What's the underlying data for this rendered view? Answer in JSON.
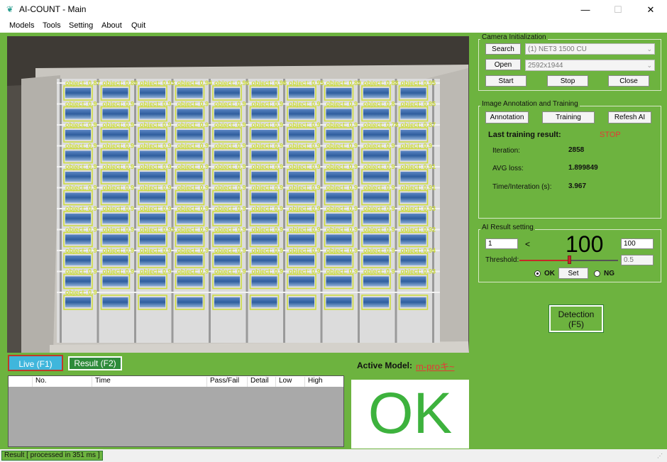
{
  "window": {
    "title": "AI-COUNT - Main",
    "minimize": "—",
    "maximize": "☐",
    "close": "✕"
  },
  "menu": [
    "Models",
    "Tools",
    "Setting",
    "About",
    "Quit"
  ],
  "camera_view": {
    "detections": [
      {
        "c": 0,
        "r": 0,
        "s": "0.87"
      },
      {
        "c": 1,
        "r": 0,
        "s": "0.89"
      },
      {
        "c": 2,
        "r": 0,
        "s": "0.93"
      },
      {
        "c": 3,
        "r": 0,
        "s": "0.94"
      },
      {
        "c": 4,
        "r": 0,
        "s": "0.96"
      },
      {
        "c": 5,
        "r": 0,
        "s": "0.96"
      },
      {
        "c": 6,
        "r": 0,
        "s": "0.95"
      },
      {
        "c": 7,
        "r": 0,
        "s": "0.89"
      },
      {
        "c": 8,
        "r": 0,
        "s": "0.88"
      },
      {
        "c": 9,
        "r": 0,
        "s": "0.95"
      },
      {
        "c": 0,
        "r": 1,
        "s": "0.9"
      },
      {
        "c": 1,
        "r": 1,
        "s": "0.9"
      },
      {
        "c": 2,
        "r": 1,
        "s": "0.9"
      },
      {
        "c": 3,
        "r": 1,
        "s": "0.9"
      },
      {
        "c": 4,
        "r": 1,
        "s": "0.9"
      },
      {
        "c": 5,
        "r": 1,
        "s": "0.9"
      },
      {
        "c": 6,
        "r": 1,
        "s": "0.9"
      },
      {
        "c": 7,
        "r": 1,
        "s": "0.9"
      },
      {
        "c": 8,
        "r": 1,
        "s": "0.8"
      },
      {
        "c": 9,
        "r": 1,
        "s": "0.85"
      },
      {
        "c": 0,
        "r": 2,
        "s": "0.9"
      },
      {
        "c": 1,
        "r": 2,
        "s": "0.9"
      },
      {
        "c": 2,
        "r": 2,
        "s": "0.9"
      },
      {
        "c": 3,
        "r": 2,
        "s": "0.9"
      },
      {
        "c": 4,
        "r": 2,
        "s": "0.9"
      },
      {
        "c": 5,
        "r": 2,
        "s": "0.9"
      },
      {
        "c": 6,
        "r": 2,
        "s": "0.9"
      },
      {
        "c": 7,
        "r": 2,
        "s": "0.9"
      },
      {
        "c": 8,
        "r": 2,
        "s": "0.78"
      },
      {
        "c": 9,
        "r": 2,
        "s": "0.87"
      },
      {
        "c": 0,
        "r": 3,
        "s": "0.9"
      },
      {
        "c": 1,
        "r": 3,
        "s": "0.9"
      },
      {
        "c": 2,
        "r": 3,
        "s": "0.9"
      },
      {
        "c": 3,
        "r": 3,
        "s": "0.9"
      },
      {
        "c": 4,
        "r": 3,
        "s": "0.9"
      },
      {
        "c": 5,
        "r": 3,
        "s": "0.9"
      },
      {
        "c": 6,
        "r": 3,
        "s": "0.9"
      },
      {
        "c": 7,
        "r": 3,
        "s": "0.9"
      },
      {
        "c": 8,
        "r": 3,
        "s": "0.9"
      },
      {
        "c": 9,
        "r": 3,
        "s": "0.9"
      },
      {
        "c": 0,
        "r": 4,
        "s": "0.9"
      },
      {
        "c": 1,
        "r": 4,
        "s": "0.9"
      },
      {
        "c": 2,
        "r": 4,
        "s": "0.9"
      },
      {
        "c": 3,
        "r": 4,
        "s": "0.9"
      },
      {
        "c": 4,
        "r": 4,
        "s": "0.9"
      },
      {
        "c": 5,
        "r": 4,
        "s": "0.9"
      },
      {
        "c": 6,
        "r": 4,
        "s": "0.9"
      },
      {
        "c": 7,
        "r": 4,
        "s": "0.9"
      },
      {
        "c": 8,
        "r": 4,
        "s": "0.9"
      },
      {
        "c": 9,
        "r": 4,
        "s": "0.91"
      },
      {
        "c": 0,
        "r": 5,
        "s": "0.9"
      },
      {
        "c": 1,
        "r": 5,
        "s": "0.9"
      },
      {
        "c": 2,
        "r": 5,
        "s": "0.9"
      },
      {
        "c": 3,
        "r": 5,
        "s": "0.9"
      },
      {
        "c": 4,
        "r": 5,
        "s": "0.9"
      },
      {
        "c": 5,
        "r": 5,
        "s": "0.9"
      },
      {
        "c": 6,
        "r": 5,
        "s": "0.9"
      },
      {
        "c": 7,
        "r": 5,
        "s": "0.9"
      },
      {
        "c": 8,
        "r": 5,
        "s": "0.9"
      },
      {
        "c": 9,
        "r": 5,
        "s": "0.91"
      },
      {
        "c": 0,
        "r": 6,
        "s": "0.9"
      },
      {
        "c": 1,
        "r": 6,
        "s": "0.9"
      },
      {
        "c": 2,
        "r": 6,
        "s": "0.9"
      },
      {
        "c": 3,
        "r": 6,
        "s": "0.9"
      },
      {
        "c": 4,
        "r": 6,
        "s": "0.9"
      },
      {
        "c": 5,
        "r": 6,
        "s": "0.9"
      },
      {
        "c": 6,
        "r": 6,
        "s": "0.9"
      },
      {
        "c": 7,
        "r": 6,
        "s": "0.9"
      },
      {
        "c": 8,
        "r": 6,
        "s": "0.9"
      },
      {
        "c": 9,
        "r": 6,
        "s": "0.93"
      },
      {
        "c": 0,
        "r": 7,
        "s": "0.9"
      },
      {
        "c": 1,
        "r": 7,
        "s": "0.9"
      },
      {
        "c": 2,
        "r": 7,
        "s": "0.93"
      },
      {
        "c": 3,
        "r": 7,
        "s": "0.9"
      },
      {
        "c": 4,
        "r": 7,
        "s": "0.9"
      },
      {
        "c": 5,
        "r": 7,
        "s": "0.9"
      },
      {
        "c": 6,
        "r": 7,
        "s": "0.9"
      },
      {
        "c": 7,
        "r": 7,
        "s": "0.9"
      },
      {
        "c": 8,
        "r": 7,
        "s": "0.9"
      },
      {
        "c": 9,
        "r": 7,
        "s": "0.92"
      },
      {
        "c": 0,
        "r": 8,
        "s": "0.9"
      },
      {
        "c": 1,
        "r": 8,
        "s": "0.9"
      },
      {
        "c": 2,
        "r": 8,
        "s": "0.9"
      },
      {
        "c": 3,
        "r": 8,
        "s": "0.9"
      },
      {
        "c": 4,
        "r": 8,
        "s": "0.9"
      },
      {
        "c": 5,
        "r": 8,
        "s": "0.9"
      },
      {
        "c": 6,
        "r": 8,
        "s": "0.9"
      },
      {
        "c": 7,
        "r": 8,
        "s": "0.9"
      },
      {
        "c": 8,
        "r": 8,
        "s": "0.9"
      },
      {
        "c": 9,
        "r": 8,
        "s": "0.94"
      },
      {
        "c": 0,
        "r": 9,
        "s": "0.9"
      },
      {
        "c": 1,
        "r": 9,
        "s": "0.9"
      },
      {
        "c": 2,
        "r": 9,
        "s": "0.9"
      },
      {
        "c": 3,
        "r": 9,
        "s": "0.9"
      },
      {
        "c": 4,
        "r": 9,
        "s": "0.9"
      },
      {
        "c": 5,
        "r": 9,
        "s": "0.9"
      },
      {
        "c": 6,
        "r": 9,
        "s": "0.9"
      },
      {
        "c": 7,
        "r": 9,
        "s": "0.9"
      },
      {
        "c": 8,
        "r": 9,
        "s": "0.9"
      },
      {
        "c": 9,
        "r": 9,
        "s": "0.93"
      },
      {
        "c": 0,
        "r": 10,
        "s": "0.9"
      },
      {
        "c": 1,
        "r": 10,
        "s": ""
      },
      {
        "c": 2,
        "r": 10,
        "s": ""
      },
      {
        "c": 3,
        "r": 10,
        "s": ""
      },
      {
        "c": 4,
        "r": 10,
        "s": ""
      },
      {
        "c": 5,
        "r": 10,
        "s": ""
      },
      {
        "c": 6,
        "r": 10,
        "s": ""
      },
      {
        "c": 7,
        "r": 10,
        "s": ""
      },
      {
        "c": 8,
        "r": 10,
        "s": ""
      },
      {
        "c": 9,
        "r": 10,
        "s": ""
      }
    ],
    "label_prefix": "object: "
  },
  "camera_init": {
    "title": "Camera Initialization",
    "search_label": "Search",
    "open_label": "Open",
    "camera_value": "(1) NET3 1500 CU",
    "resolution_value": "2592x1944",
    "start_label": "Start",
    "stop_label": "Stop",
    "close_label": "Close"
  },
  "annotation": {
    "title": "Image Annotation and Training",
    "annotation_label": "Annotation",
    "training_label": "Training",
    "refresh_label": "Refesh AI",
    "last_result_label": "Last training result:",
    "last_result_value": "STOP",
    "iteration_label": "Iteration:",
    "iteration_value": "2858",
    "avg_loss_label": "AVG loss:",
    "avg_loss_value": "1.899849",
    "time_label": "Time/Interation (s):",
    "time_value": "3.967"
  },
  "ai_result": {
    "title": "AI Result setting",
    "min_value": "1",
    "less_than": "<",
    "count_value": "100",
    "max_value": "100",
    "threshold_label": "Threshold:",
    "threshold_value": "0.5",
    "threshold_fraction": 0.5,
    "ok_label": "OK",
    "set_label": "Set",
    "ng_label": "NG"
  },
  "detection": {
    "line1": "Detection",
    "line2": "(F5)"
  },
  "tabs": {
    "live": "Live (F1)",
    "result": "Result (F2)"
  },
  "active_model": {
    "label": "Active Model:",
    "value": "m-proキ~"
  },
  "grid": {
    "columns": [
      "",
      "No.",
      "Time",
      "Pass/Fail",
      "Detail",
      "Low",
      "High"
    ]
  },
  "result_display": "OK",
  "status": "Result [ processed in 351 ms ]",
  "colors": {
    "main_green": "#6db33f",
    "ok_green": "#3db23d",
    "live_blue": "#3fb6dc",
    "result_dark_green": "#2e8b3a",
    "stop_red": "#e53935",
    "detect_green": "#cddc39"
  }
}
